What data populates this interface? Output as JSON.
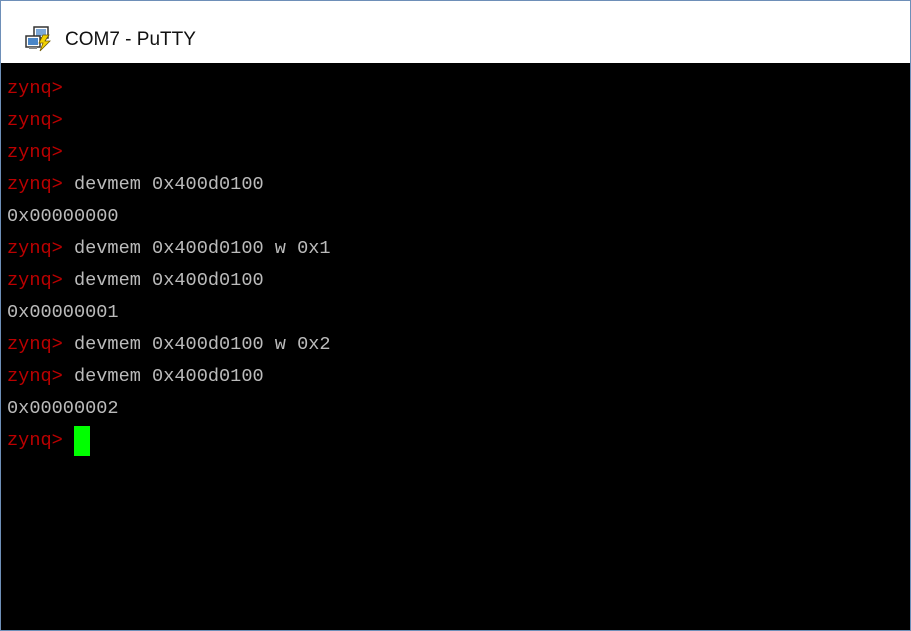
{
  "window": {
    "title": "COM7 - PuTTY",
    "icon": "putty-app-icon"
  },
  "colors": {
    "prompt": "#bb0000",
    "text": "#bbbbbb",
    "background": "#000000",
    "cursor": "#00ff00"
  },
  "terminal": {
    "lines": [
      {
        "prompt": "zynq>",
        "text": ""
      },
      {
        "prompt": "zynq>",
        "text": ""
      },
      {
        "prompt": "zynq>",
        "text": ""
      },
      {
        "prompt": "zynq>",
        "text": " devmem 0x400d0100"
      },
      {
        "prompt": "",
        "text": "0x00000000"
      },
      {
        "prompt": "zynq>",
        "text": " devmem 0x400d0100 w 0x1"
      },
      {
        "prompt": "zynq>",
        "text": " devmem 0x400d0100"
      },
      {
        "prompt": "",
        "text": "0x00000001"
      },
      {
        "prompt": "zynq>",
        "text": " devmem 0x400d0100 w 0x2"
      },
      {
        "prompt": "zynq>",
        "text": " devmem 0x400d0100"
      },
      {
        "prompt": "",
        "text": "0x00000002"
      },
      {
        "prompt": "zynq>",
        "text": " "
      }
    ]
  }
}
